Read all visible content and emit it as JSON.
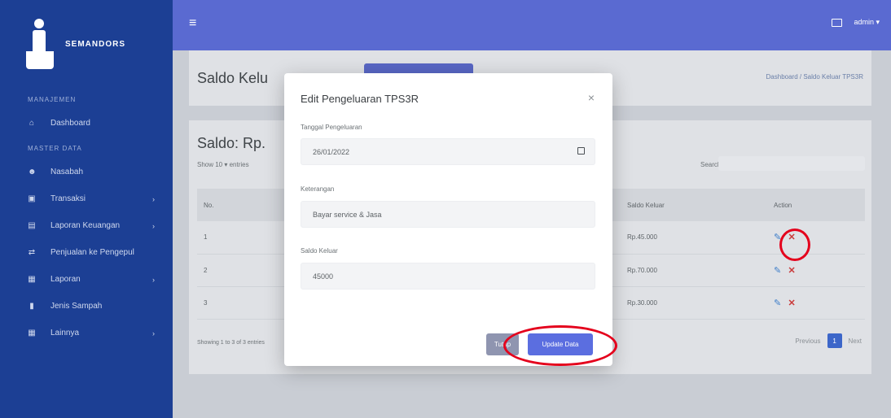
{
  "sidebar": {
    "logo_text": "SEMANDORS",
    "section_1": "MANAJEMEN",
    "section_2": "MASTER DATA",
    "items": [
      {
        "label": "Dashboard",
        "icon": "home-icon",
        "has_chevron": false
      },
      {
        "label": "Nasabah",
        "icon": "users-icon",
        "has_chevron": false
      },
      {
        "label": "Transaksi",
        "icon": "cash-icon",
        "has_chevron": true
      },
      {
        "label": "Laporan Keuangan",
        "icon": "book-icon",
        "has_chevron": true
      },
      {
        "label": "Penjualan ke Pengepul",
        "icon": "truck-icon",
        "has_chevron": false
      },
      {
        "label": "Laporan",
        "icon": "file-icon",
        "has_chevron": true
      },
      {
        "label": "Jenis Sampah",
        "icon": "trash-icon",
        "has_chevron": false
      },
      {
        "label": "Lainnya",
        "icon": "grid-icon",
        "has_chevron": true
      }
    ]
  },
  "topbar": {
    "user_label": "admin ▾"
  },
  "page": {
    "title": "Saldo Kelu",
    "breadcrumb": "Dashboard / Saldo Keluar TPS3R",
    "saldo_label": "Saldo: Rp.",
    "show_entries": "Show  10 ▾  entries",
    "search_label": "Search:",
    "table": {
      "headers": [
        "No.",
        "",
        "Saldo Keluar",
        "Action"
      ],
      "rows": [
        {
          "no": "1",
          "saldo": "Rp.45.000"
        },
        {
          "no": "2",
          "saldo": "Rp.70.000"
        },
        {
          "no": "3",
          "saldo": "Rp.30.000"
        }
      ]
    },
    "showing_text": "Showing 1 to 3 of 3 entries",
    "pager": {
      "prev": "Previous",
      "current": "1",
      "next": "Next"
    }
  },
  "modal": {
    "title": "Edit Pengeluaran TPS3R",
    "close_symbol": "×",
    "fields": [
      {
        "label": "Tanggal Pengeluaran",
        "value": "26/01/2022"
      },
      {
        "label": "Keterangan",
        "value": "Bayar service & Jasa"
      },
      {
        "label": "Saldo Keluar",
        "value": "45000"
      }
    ],
    "btn_close_label": "Tutup",
    "btn_update_label": "Update Data"
  },
  "colors": {
    "sidebar": "#1c3f94",
    "topbar": "#5a6ad1",
    "primary_button": "#5b6ee0",
    "annotation": "#e4001c"
  }
}
